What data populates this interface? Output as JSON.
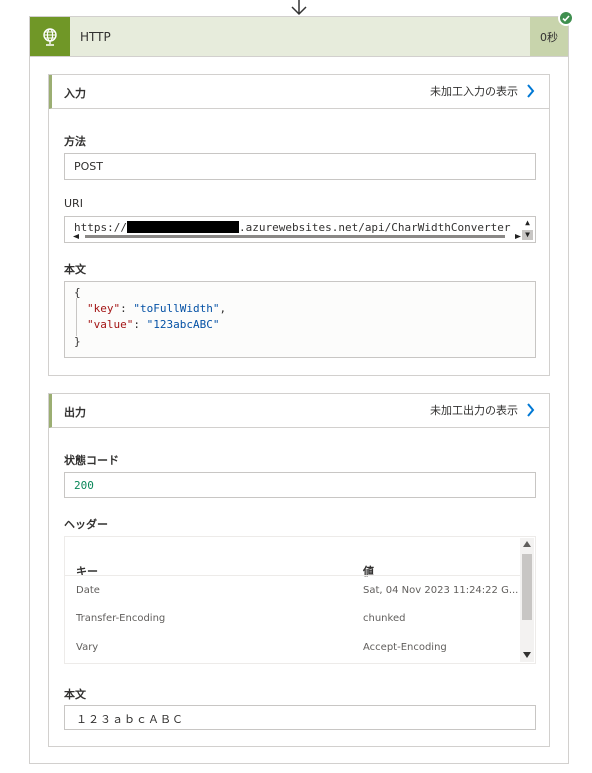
{
  "card": {
    "title": "HTTP",
    "duration": "0秒",
    "icon": "globe-icon",
    "accent": "#709727",
    "status": "succeeded"
  },
  "inputs": {
    "title": "入力",
    "raw_link": "未加工入力の表示",
    "method_label": "方法",
    "method_value": "POST",
    "uri_label": "URI",
    "uri_prefix": "https://",
    "uri_suffix": ".azurewebsites.net/api/CharWidthConverter",
    "body_label": "本文",
    "body": {
      "open": "{",
      "key1": "\"key\"",
      "val1": "\"toFullWidth\"",
      "key2": "\"value\"",
      "val2": "\"123abcABC\"",
      "close": "}"
    }
  },
  "outputs": {
    "title": "出力",
    "raw_link": "未加工出力の表示",
    "status_label": "状態コード",
    "status_value": "200",
    "headers_label": "ヘッダー",
    "headers_columns": [
      "キー",
      "値"
    ],
    "headers_rows": [
      {
        "key": "Date",
        "value": "Sat, 04 Nov 2023 11:24:22 G..."
      },
      {
        "key": "Transfer-Encoding",
        "value": "chunked"
      },
      {
        "key": "Vary",
        "value": "Accept-Encoding"
      }
    ],
    "body_label": "本文",
    "body_value": "１２３ａｂｃＡＢＣ"
  }
}
